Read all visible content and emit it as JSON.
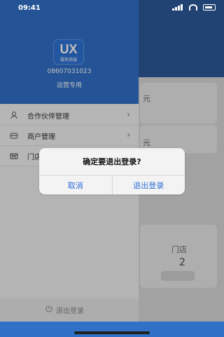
{
  "status": {
    "time": "09:41"
  },
  "drawer": {
    "logo": {
      "text": "UX",
      "subtitle": "服务商端"
    },
    "phone": "08607031023",
    "role": "运营专用",
    "menu": [
      {
        "label": "合作伙伴管理",
        "icon": "person-icon"
      },
      {
        "label": "商户管理",
        "icon": "store-icon"
      },
      {
        "label": "门店",
        "icon": "shop-icon"
      }
    ],
    "logout": {
      "label": "退出登录",
      "icon": "power-icon"
    }
  },
  "dialog": {
    "title": "确定要退出登录?",
    "cancel": "取消",
    "confirm": "退出登录"
  },
  "background": {
    "snippets": [
      "元",
      "元",
      "门店",
      "2"
    ]
  },
  "colors": {
    "primary": "#3071c7",
    "accent": "#2f6fd8",
    "overlay": "rgba(0,0,0,0.25)"
  }
}
